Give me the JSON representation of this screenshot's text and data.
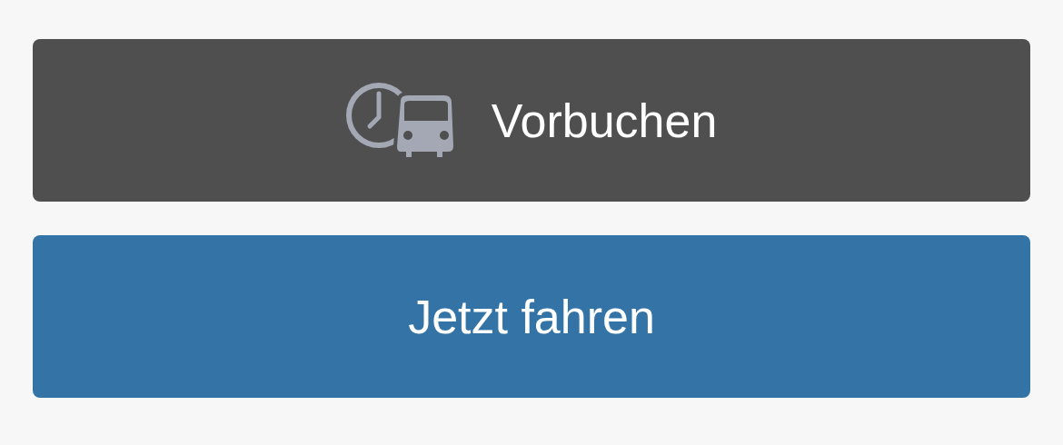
{
  "buttons": [
    {
      "label": "Vorbuchen",
      "kind": "secondary"
    },
    {
      "label": "Jetzt fahren",
      "kind": "primary"
    }
  ]
}
